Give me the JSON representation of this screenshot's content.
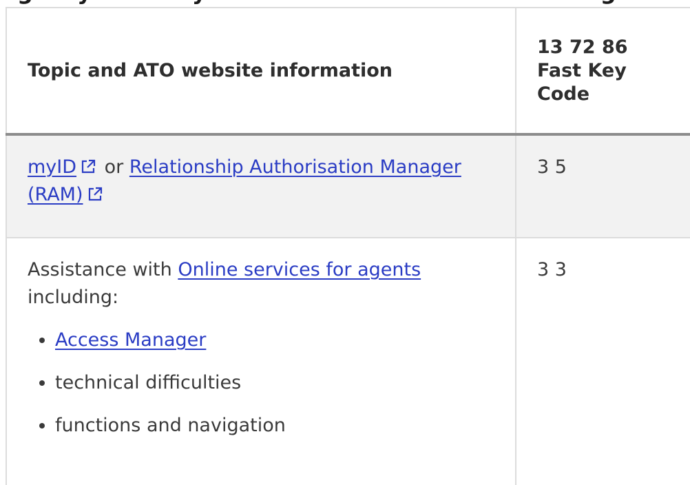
{
  "heading": {
    "fragment": "Agency Fast Key Codes for Online services for agents support"
  },
  "table": {
    "headers": {
      "topic": "Topic and ATO website information",
      "code_line1": "13 72 86",
      "code_line2": "Fast Key",
      "code_line3": "Code"
    },
    "row1": {
      "link1": "myID",
      "connector": "or",
      "link2_part1": "Relationship Authorisation Manager",
      "link2_part2": "(RAM)",
      "code": "3 5"
    },
    "row2": {
      "intro_prefix": "Assistance with",
      "intro_link": "Online services for agents",
      "intro_suffix": "including:",
      "bullets": {
        "b1": "Access Manager",
        "b2": "technical difficulties",
        "b3": "functions and navigation"
      },
      "code": "3 3"
    }
  },
  "icons": {
    "external_link": "external-link-icon"
  },
  "colors": {
    "link": "#2a3cc4",
    "shaded_row": "#f2f2f2",
    "border": "#dcdcdc",
    "header_rule": "#8c8c8c"
  }
}
